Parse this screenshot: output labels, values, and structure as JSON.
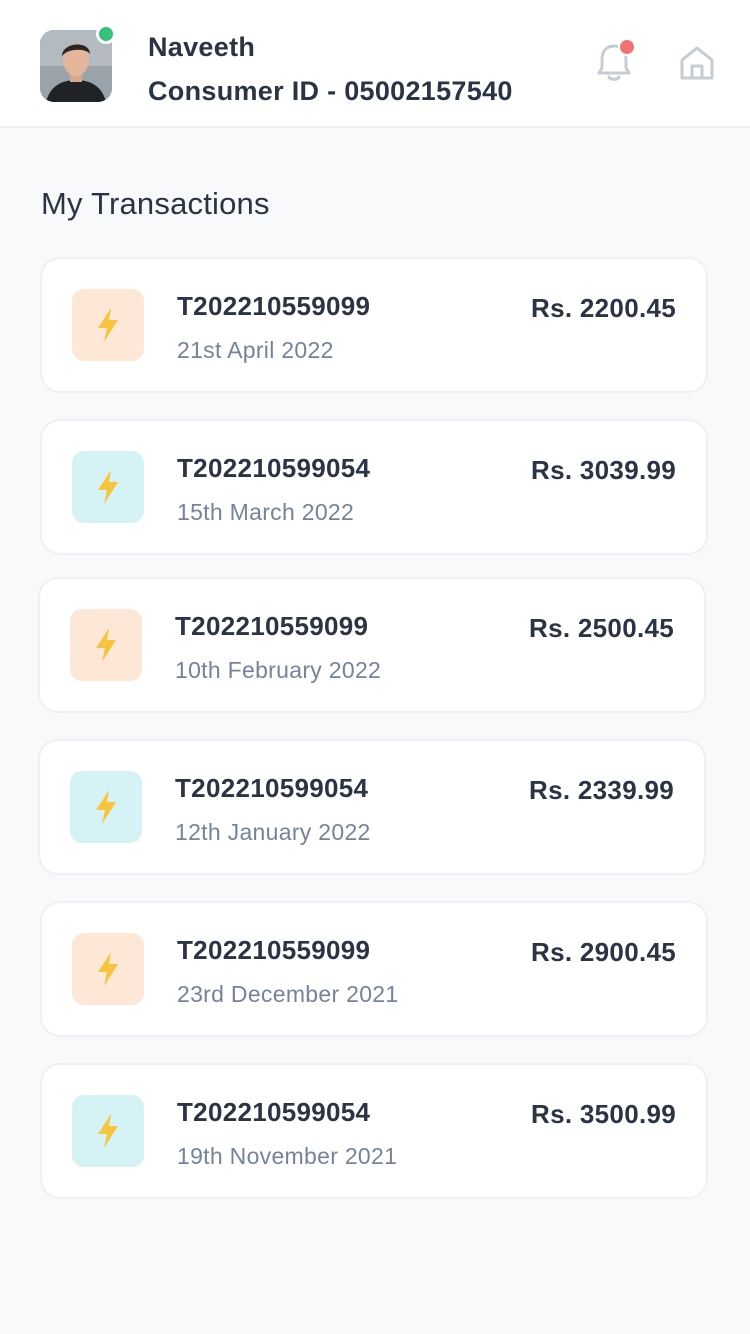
{
  "header": {
    "user_name": "Naveeth",
    "consumer_id": "Consumer ID - 05002157540",
    "online_status_color": "#34c17b",
    "notification_dot_color": "#f27373"
  },
  "main": {
    "section_title": "My Transactions",
    "transactions": [
      {
        "id": "T202210559099",
        "date": "21st April 2022",
        "amount": "Rs. 2200.45",
        "icon": "lightning-icon",
        "icon_bg": "#fde7d7"
      },
      {
        "id": "T202210599054",
        "date": "15th March 2022",
        "amount": "Rs. 3039.99",
        "icon": "lightning-icon",
        "icon_bg": "#d5f2f4"
      },
      {
        "id": "T202210559099",
        "date": "10th February 2022",
        "amount": "Rs. 2500.45",
        "icon": "lightning-icon",
        "icon_bg": "#fde7d7"
      },
      {
        "id": "T202210599054",
        "date": "12th January 2022",
        "amount": "Rs. 2339.99",
        "icon": "lightning-icon",
        "icon_bg": "#d5f2f4"
      },
      {
        "id": "T202210559099",
        "date": "23rd December 2021",
        "amount": "Rs. 2900.45",
        "icon": "lightning-icon",
        "icon_bg": "#fde7d7"
      },
      {
        "id": "T202210599054",
        "date": "19th November 2021",
        "amount": "Rs. 3500.99",
        "icon": "lightning-icon",
        "icon_bg": "#d5f2f4"
      }
    ]
  }
}
